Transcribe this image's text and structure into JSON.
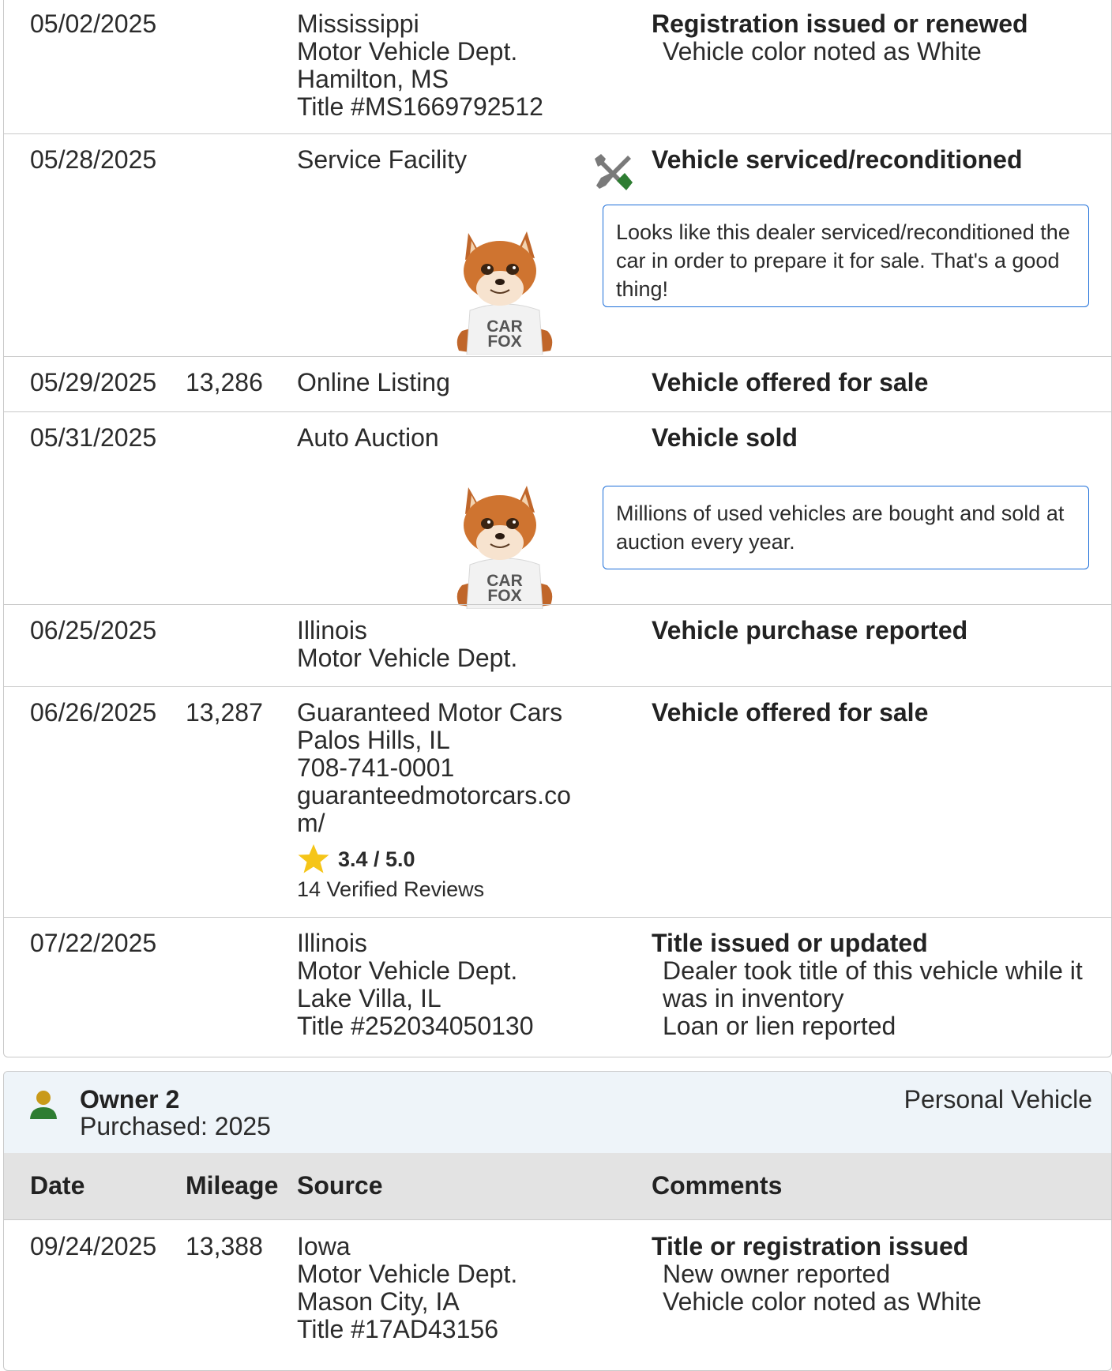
{
  "owner1_records": [
    {
      "date": "05/02/2025",
      "mileage": "",
      "source": [
        "Mississippi",
        "Motor Vehicle Dept.",
        "Hamilton, MS",
        "Title #MS1669792512"
      ],
      "comment_title": "Registration issued or renewed",
      "comment_lines": [
        "Vehicle color noted as White"
      ]
    },
    {
      "date": "05/28/2025",
      "mileage": "",
      "source": [
        "Service Facility"
      ],
      "comment_title": "Vehicle serviced/reconditioned",
      "comment_lines": [],
      "icon": "wrench-screwdriver-icon",
      "note": "Looks like this dealer serviced/reconditioned the car in order to prepare it for sale. That's a good thing!"
    },
    {
      "date": "05/29/2025",
      "mileage": "13,286",
      "source": [
        "Online Listing"
      ],
      "comment_title": "Vehicle offered for sale",
      "comment_lines": []
    },
    {
      "date": "05/31/2025",
      "mileage": "",
      "source": [
        "Auto Auction"
      ],
      "comment_title": "Vehicle sold",
      "comment_lines": [],
      "note": "Millions of used vehicles are bought and sold at auction every year."
    },
    {
      "date": "06/25/2025",
      "mileage": "",
      "source": [
        "Illinois",
        "Motor Vehicle Dept."
      ],
      "comment_title": "Vehicle purchase reported",
      "comment_lines": []
    },
    {
      "date": "06/26/2025",
      "mileage": "13,287",
      "source": [
        "Guaranteed Motor Cars",
        "Palos Hills, IL",
        "708-741-0001",
        "guaranteedmotorcars.com/"
      ],
      "rating": "3.4 / 5.0",
      "reviews": "14 Verified Reviews",
      "comment_title": "Vehicle offered for sale",
      "comment_lines": []
    },
    {
      "date": "07/22/2025",
      "mileage": "",
      "source": [
        "Illinois",
        "Motor Vehicle Dept.",
        "Lake Villa, IL",
        "Title #252034050130"
      ],
      "comment_title": "Title issued or updated",
      "comment_lines": [
        "Dealer took title of this vehicle while it was in inventory",
        "Loan or lien reported"
      ]
    }
  ],
  "fox_shirt_text": [
    "CAR",
    "FOX"
  ],
  "owner2": {
    "title": "Owner 2",
    "purchased": "Purchased: 2025",
    "type": "Personal Vehicle",
    "icon": "person-icon"
  },
  "columns": {
    "date": "Date",
    "mileage": "Mileage",
    "source": "Source",
    "comments": "Comments"
  },
  "owner2_records": [
    {
      "date": "09/24/2025",
      "mileage": "13,388",
      "source": [
        "Iowa",
        "Motor Vehicle Dept.",
        "Mason City, IA",
        "Title #17AD43156"
      ],
      "comment_title": "Title or registration issued",
      "comment_lines": [
        "New owner reported",
        "Vehicle color noted as White"
      ]
    }
  ],
  "colors": {
    "accent_blue": "#1e6fd9",
    "star": "#f5c518",
    "person_green": "#2e7d32",
    "person_gold": "#c99a1a",
    "tool_green": "#2e7d32"
  }
}
